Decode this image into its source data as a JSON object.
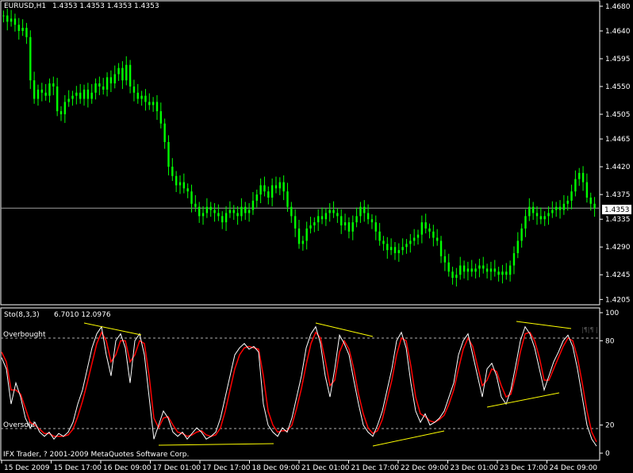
{
  "colors": {
    "background": "#000000",
    "frame": "#ffffff",
    "bullish_bar": "#00ff00",
    "main_line": "#ffffff",
    "signal_line": "#ff0000",
    "trendline": "#ffff00",
    "level_line": "#b0b0b0",
    "price_line": "#a0a0a0",
    "text": "#ffffff",
    "watermark": "#555555"
  },
  "header": {
    "symbol_label": "EURUSD,H1",
    "ohlc": "1.4353 1.4353 1.4353 1.4353"
  },
  "indicator": {
    "label": "Sto(8,3,3)",
    "values": "6.7010 12.0976",
    "overbought_label": "Overbought",
    "oversold_label": "Oversold",
    "watermark": "|¶|¶ |"
  },
  "copyright": "IFX Trader, ? 2001-2009 MetaQuotes Software Corp.",
  "current_price_label": "1.4353",
  "chart_data": [
    {
      "type": "ohlc",
      "title": "EURUSD,H1",
      "price_axis_ticks": [
        "1.4680",
        "1.4640",
        "1.4595",
        "1.4550",
        "1.4505",
        "1.4465",
        "1.4420",
        "1.4375",
        "1.4335",
        "1.4290",
        "1.4245",
        "1.4205"
      ],
      "x_tick_labels": [
        "15 Dec 2009",
        "15 Dec 17:00",
        "16 Dec 09:00",
        "17 Dec 01:00",
        "17 Dec 17:00",
        "18 Dec 09:00",
        "21 Dec 01:00",
        "21 Dec 17:00",
        "22 Dec 09:00",
        "23 Dec 01:00",
        "23 Dec 17:00",
        "24 Dec 09:00"
      ],
      "ylim": [
        1.4199,
        1.4685
      ],
      "current_price": 1.4353,
      "series": [
        {
          "values": [
            1.4665,
            1.4655,
            1.466,
            1.465,
            1.464,
            1.4645,
            1.463,
            1.456,
            1.453,
            1.4545,
            1.454,
            1.4535,
            1.4555,
            1.455,
            1.451,
            1.4505,
            1.4525,
            1.453,
            1.4535,
            1.454,
            1.453,
            1.4545,
            1.453,
            1.454,
            1.4555,
            1.455,
            1.4545,
            1.4565,
            1.4555,
            1.457,
            1.458,
            1.456,
            1.4585,
            1.455,
            1.454,
            1.453,
            1.4535,
            1.4525,
            1.452,
            1.4525,
            1.451,
            1.449,
            1.446,
            1.442,
            1.4405,
            1.439,
            1.4395,
            1.4385,
            1.438,
            1.436,
            1.4355,
            1.434,
            1.4345,
            1.4355,
            1.435,
            1.4345,
            1.434,
            1.433,
            1.4345,
            1.435,
            1.4345,
            1.434,
            1.4355,
            1.4345,
            1.435,
            1.4365,
            1.4375,
            1.439,
            1.438,
            1.437,
            1.439,
            1.4385,
            1.4395,
            1.438,
            1.4355,
            1.434,
            1.432,
            1.4295,
            1.43,
            1.432,
            1.4325,
            1.433,
            1.434,
            1.4335,
            1.4345,
            1.435,
            1.4345,
            1.434,
            1.4325,
            1.433,
            1.4315,
            1.433,
            1.434,
            1.4355,
            1.4345,
            1.4335,
            1.433,
            1.4315,
            1.43,
            1.4295,
            1.4285,
            1.429,
            1.428,
            1.4285,
            1.429,
            1.4295,
            1.43,
            1.4305,
            1.431,
            1.433,
            1.432,
            1.4315,
            1.4305,
            1.43,
            1.4275,
            1.4265,
            1.425,
            1.424,
            1.4245,
            1.426,
            1.425,
            1.4255,
            1.425,
            1.4255,
            1.426,
            1.4255,
            1.425,
            1.4255,
            1.425,
            1.4245,
            1.425,
            1.4245,
            1.426,
            1.428,
            1.43,
            1.432,
            1.434,
            1.4355,
            1.4345,
            1.434,
            1.4335,
            1.434,
            1.4345,
            1.435,
            1.4355,
            1.435,
            1.436,
            1.4365,
            1.438,
            1.44,
            1.441,
            1.4395,
            1.437,
            1.436,
            1.4353
          ]
        }
      ]
    },
    {
      "type": "line",
      "title": "Sto(8,3,3)",
      "ylim": [
        0,
        100
      ],
      "y_ticks": [
        100,
        80,
        20,
        0
      ],
      "levels": [
        {
          "value": 80,
          "label": "Overbought"
        },
        {
          "value": 20,
          "label": "Oversold"
        }
      ],
      "series": [
        {
          "values": [
            68,
            60,
            35,
            50,
            40,
            25,
            18,
            22,
            15,
            12,
            15,
            10,
            14,
            12,
            15,
            22,
            35,
            45,
            60,
            75,
            85,
            90,
            70,
            55,
            80,
            85,
            75,
            50,
            80,
            85,
            70,
            40,
            10,
            20,
            30,
            25,
            15,
            12,
            15,
            10,
            14,
            18,
            15,
            10,
            12,
            15,
            25,
            40,
            55,
            70,
            75,
            78,
            74,
            76,
            72,
            35,
            20,
            15,
            12,
            18,
            15,
            25,
            40,
            55,
            75,
            85,
            90,
            78,
            55,
            40,
            60,
            84,
            78,
            70,
            52,
            35,
            20,
            15,
            12,
            20,
            30,
            45,
            60,
            80,
            86,
            75,
            50,
            30,
            22,
            28,
            20,
            22,
            25,
            30,
            40,
            50,
            70,
            80,
            85,
            70,
            55,
            40,
            60,
            64,
            55,
            40,
            35,
            45,
            62,
            80,
            90,
            85,
            75,
            60,
            45,
            55,
            65,
            72,
            80,
            84,
            76,
            60,
            40,
            20,
            10,
            5
          ]
        },
        {
          "values": [
            72,
            65,
            45,
            45,
            42,
            32,
            22,
            20,
            17,
            14,
            14,
            12,
            12,
            12,
            13,
            17,
            26,
            37,
            50,
            64,
            78,
            86,
            80,
            65,
            70,
            80,
            80,
            65,
            70,
            80,
            78,
            55,
            25,
            18,
            25,
            26,
            20,
            15,
            14,
            12,
            13,
            15,
            16,
            13,
            12,
            13,
            18,
            30,
            45,
            60,
            70,
            75,
            76,
            75,
            74,
            55,
            30,
            20,
            15,
            16,
            16,
            20,
            32,
            46,
            63,
            78,
            86,
            82,
            66,
            48,
            52,
            72,
            80,
            74,
            60,
            42,
            28,
            18,
            14,
            16,
            24,
            38,
            52,
            70,
            82,
            80,
            62,
            40,
            28,
            26,
            23,
            22,
            24,
            27,
            35,
            45,
            60,
            74,
            82,
            76,
            62,
            48,
            52,
            60,
            58,
            48,
            40,
            42,
            55,
            72,
            85,
            86,
            80,
            68,
            52,
            52,
            60,
            68,
            76,
            82,
            80,
            68,
            50,
            30,
            15,
            8
          ]
        }
      ]
    }
  ]
}
